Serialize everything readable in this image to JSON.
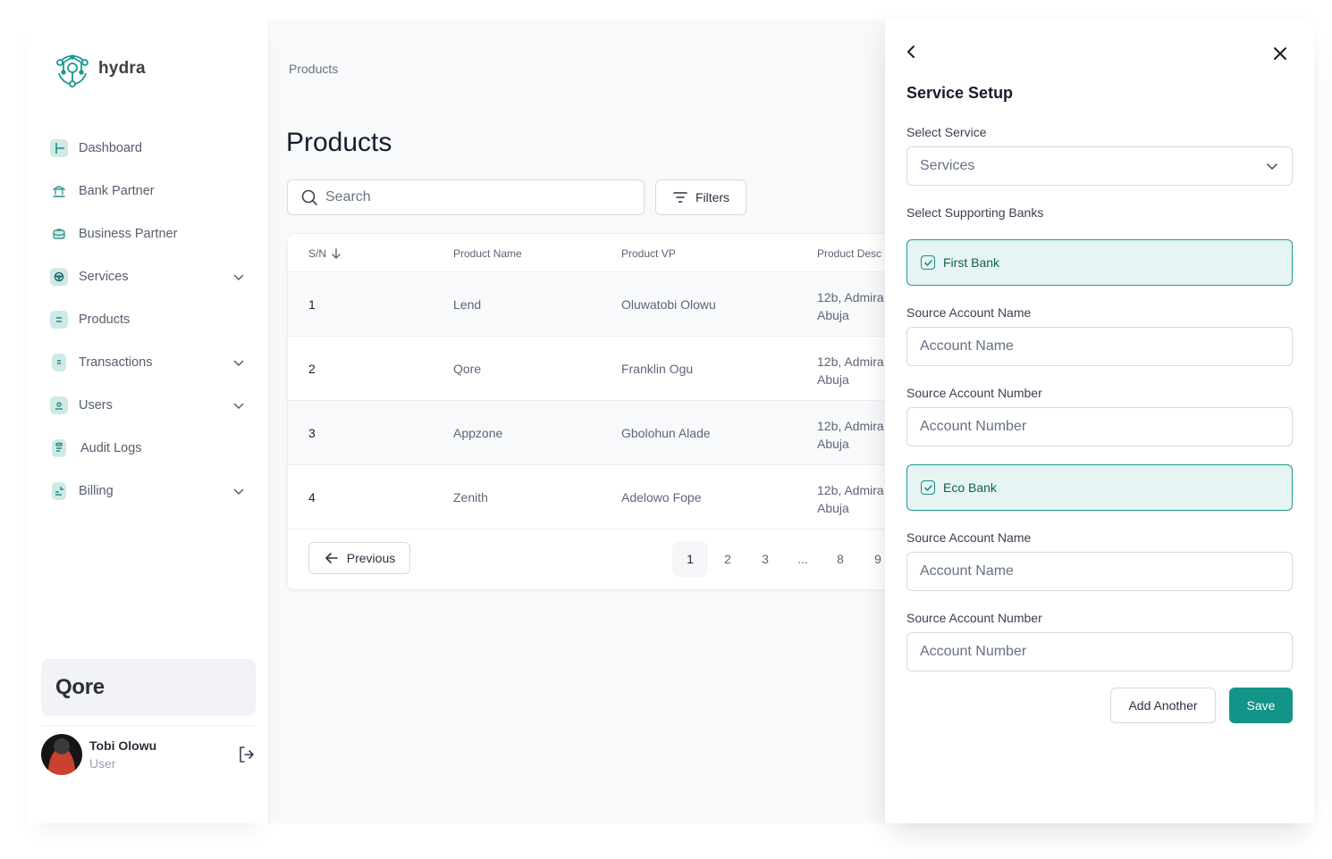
{
  "app": {
    "name": "hydra",
    "logo_icon": "hydra-hex-network-logo"
  },
  "sidebar": {
    "items": [
      {
        "label": "Dashboard",
        "icon": "dashboard-icon",
        "expandable": false
      },
      {
        "label": "Bank Partner",
        "icon": "bank-icon",
        "expandable": false
      },
      {
        "label": "Business Partner",
        "icon": "briefcase-icon",
        "expandable": false
      },
      {
        "label": "Services",
        "icon": "services-icon",
        "expandable": true
      },
      {
        "label": "Products",
        "icon": "products-icon",
        "expandable": false
      },
      {
        "label": "Transactions",
        "icon": "receipt-icon",
        "expandable": true
      },
      {
        "label": "Users",
        "icon": "user-icon",
        "expandable": true
      },
      {
        "label": "Audit Logs",
        "icon": "clipboard-icon",
        "expandable": false
      },
      {
        "label": "Billing",
        "icon": "billing-icon",
        "expandable": true
      }
    ],
    "organization": "Qore",
    "user": {
      "name": "Tobi Olowu",
      "role": "User"
    }
  },
  "main": {
    "breadcrumb": "Products",
    "title": "Products",
    "search": {
      "placeholder": "Search",
      "value": ""
    },
    "filters_label": "Filters",
    "table": {
      "columns": [
        "S/N",
        "Product Name",
        "Product VP",
        "Product Desc"
      ],
      "sort_column": "S/N",
      "sort_direction": "descending",
      "rows": [
        {
          "sn": "1",
          "name": "Lend",
          "vp": "Oluwatobi Olowu",
          "desc": "12b, Admira Abuja"
        },
        {
          "sn": "2",
          "name": "Qore",
          "vp": "Franklin Ogu",
          "desc": "12b, Admira Abuja"
        },
        {
          "sn": "3",
          "name": "Appzone",
          "vp": "Gbolohun Alade",
          "desc": "12b, Admira Abuja"
        },
        {
          "sn": "4",
          "name": "Zenith",
          "vp": "Adelowo Fope",
          "desc": "12b, Admira Abuja"
        }
      ]
    },
    "pagination": {
      "previous_label": "Previous",
      "pages": [
        "1",
        "2",
        "3",
        "...",
        "8",
        "9"
      ],
      "current_page": "1"
    }
  },
  "drawer": {
    "title": "Service Setup",
    "select_service_label": "Select Service",
    "select_service_value": "Services",
    "supporting_banks_label": "Select Supporting Banks",
    "banks": [
      {
        "name": "First Bank",
        "checked": true,
        "account_name_label": "Source Account  Name",
        "account_name_placeholder": "Account Name",
        "account_number_label": "Source Account Number",
        "account_number_placeholder": "Account Number"
      },
      {
        "name": "Eco Bank",
        "checked": true,
        "account_name_label": "Source Account  Name",
        "account_name_placeholder": "Account Name",
        "account_number_label": "Source Account Number",
        "account_number_placeholder": "Account Number"
      }
    ],
    "add_another_label": "Add Another",
    "save_label": "Save"
  },
  "colors": {
    "brand": "#149488",
    "brand_light": "#e6f4f3",
    "icon_bg": "#cfe9e6",
    "text_primary": "#161c2b",
    "text_muted": "#667085",
    "border": "#d6d9e0",
    "page_bg": "#f8f9fb"
  }
}
